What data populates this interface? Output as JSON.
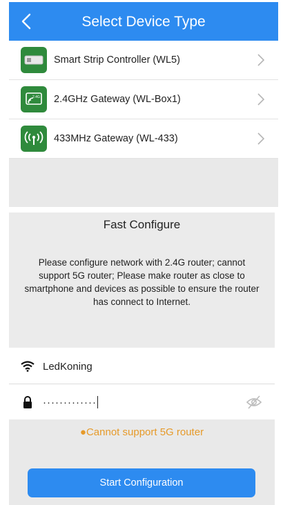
{
  "header": {
    "title": "Select Device Type",
    "back_icon": "chevron-left-icon",
    "bg_color": "#2d8bf0"
  },
  "devices": [
    {
      "label": "Smart Strip Controller (WL5)",
      "icon": "strip-controller-icon"
    },
    {
      "label": "2.4GHz Gateway (WL-Box1)",
      "icon": "gateway-24ghz-icon"
    },
    {
      "label": "433MHz Gateway (WL-433)",
      "icon": "gateway-433-icon"
    }
  ],
  "fast_configure": {
    "title": "Fast Configure",
    "description": "Please configure network with 2.4G router; cannot support 5G router; Please make router as close to smartphone and devices as possible to ensure the router has connect to Internet."
  },
  "wifi": {
    "ssid": "LedKoning",
    "password_masked": "·············",
    "wifi_icon": "wifi-icon",
    "lock_icon": "lock-icon",
    "toggle_icon": "eye-off-icon"
  },
  "warning": {
    "text": "●Cannot support 5G router",
    "color": "#e69a2a"
  },
  "start_button": {
    "label": "Start Configuration"
  }
}
